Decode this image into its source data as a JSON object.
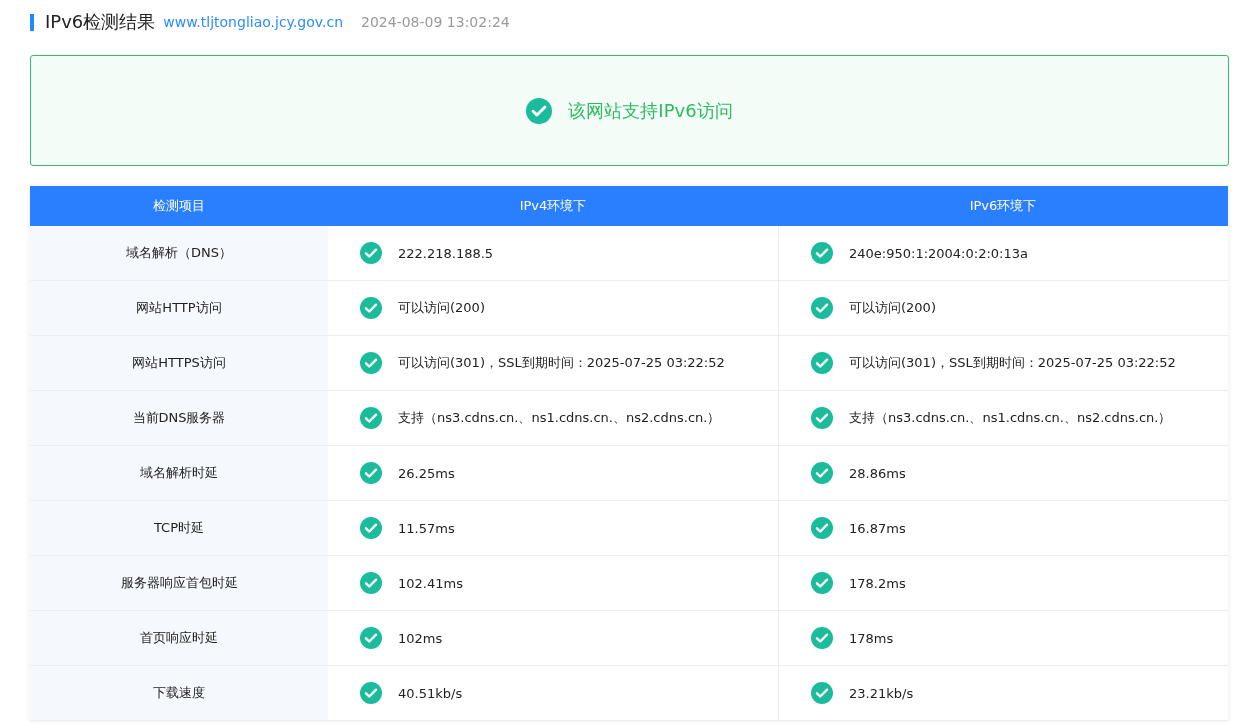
{
  "header": {
    "title": "IPv6检测结果",
    "domain": "www.tljtongliao.jcy.gov.cn",
    "time": "2024-08-09 13:02:24"
  },
  "banner": {
    "passed": true,
    "message": "该网站支持IPv6访问"
  },
  "table": {
    "columns": [
      "检测项目",
      "IPv4环境下",
      "IPv6环境下"
    ],
    "rows": [
      {
        "item": "域名解析（DNS）",
        "ipv4": {
          "passed": true,
          "value": "222.218.188.5"
        },
        "ipv6": {
          "passed": true,
          "value": "240e:950:1:2004:0:2:0:13a"
        }
      },
      {
        "item": "网站HTTP访问",
        "ipv4": {
          "passed": true,
          "value": "可以访问(200)"
        },
        "ipv6": {
          "passed": true,
          "value": "可以访问(200)"
        }
      },
      {
        "item": "网站HTTPS访问",
        "ipv4": {
          "passed": true,
          "value": "可以访问(301)，SSL到期时间：2025-07-25 03:22:52"
        },
        "ipv6": {
          "passed": true,
          "value": "可以访问(301)，SSL到期时间：2025-07-25 03:22:52"
        }
      },
      {
        "item": "当前DNS服务器",
        "ipv4": {
          "passed": true,
          "value": "支持（ns3.cdns.cn.、ns1.cdns.cn.、ns2.cdns.cn.）"
        },
        "ipv6": {
          "passed": true,
          "value": "支持（ns3.cdns.cn.、ns1.cdns.cn.、ns2.cdns.cn.）"
        }
      },
      {
        "item": "域名解析时延",
        "ipv4": {
          "passed": true,
          "value": "26.25ms"
        },
        "ipv6": {
          "passed": true,
          "value": "28.86ms"
        }
      },
      {
        "item": "TCP时延",
        "ipv4": {
          "passed": true,
          "value": "11.57ms"
        },
        "ipv6": {
          "passed": true,
          "value": "16.87ms"
        }
      },
      {
        "item": "服务器响应首包时延",
        "ipv4": {
          "passed": true,
          "value": "102.41ms"
        },
        "ipv6": {
          "passed": true,
          "value": "178.2ms"
        }
      },
      {
        "item": "首页响应时延",
        "ipv4": {
          "passed": true,
          "value": "102ms"
        },
        "ipv6": {
          "passed": true,
          "value": "178ms"
        }
      },
      {
        "item": "下载速度",
        "ipv4": {
          "passed": true,
          "value": "40.51kb/s"
        },
        "ipv6": {
          "passed": true,
          "value": "23.21kb/s"
        }
      }
    ]
  }
}
